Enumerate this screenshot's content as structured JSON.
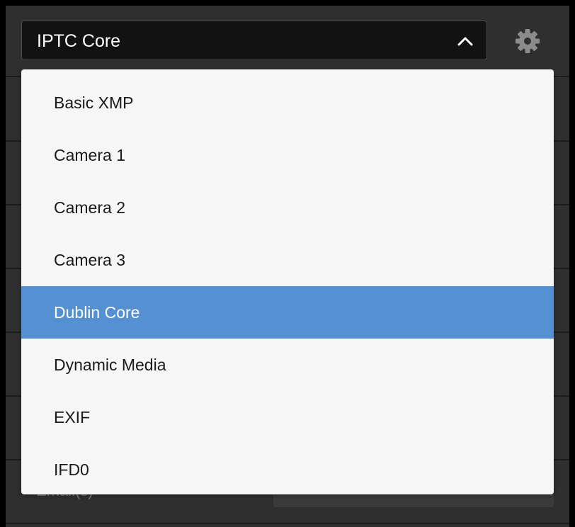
{
  "metadata_select": {
    "selected": "IPTC Core"
  },
  "settings": {
    "icon": "gear-icon"
  },
  "background_field": {
    "label": "Email(s)"
  },
  "dropdown": {
    "options": [
      "Basic XMP",
      "Camera 1",
      "Camera 2",
      "Camera 3",
      "Dublin Core",
      "Dynamic Media",
      "EXIF",
      "IFD0"
    ],
    "highlighted": "Dublin Core"
  },
  "colors": {
    "highlight": "#5591d2",
    "panel": "#2f2f2f",
    "menu_background": "#f6f6f6"
  }
}
